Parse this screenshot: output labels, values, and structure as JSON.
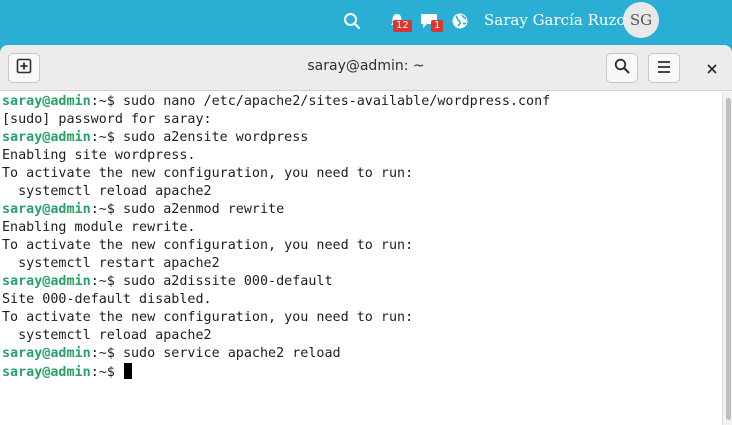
{
  "panel": {
    "icons": [
      "search-icon",
      "notifications-icon",
      "messages-icon",
      "network-globe-icon"
    ],
    "notifications_count": "12",
    "messages_count": "1",
    "user_name": "Saray García Ruzo",
    "avatar_initials": "SG"
  },
  "window": {
    "title": "saray@admin: ~",
    "buttons": [
      "new-tab-icon",
      "search-icon",
      "menu-icon",
      "close-icon"
    ]
  },
  "terminal": {
    "prompt_user": "saray@admin",
    "prompt_path": ":~$ ",
    "lines": [
      {
        "type": "prompt",
        "cmd": "sudo nano /etc/apache2/sites-available/wordpress.conf"
      },
      {
        "type": "out",
        "text": "[sudo] password for saray:"
      },
      {
        "type": "prompt",
        "cmd": "sudo a2ensite wordpress"
      },
      {
        "type": "out",
        "text": "Enabling site wordpress."
      },
      {
        "type": "out",
        "text": "To activate the new configuration, you need to run:"
      },
      {
        "type": "out",
        "text": "  systemctl reload apache2"
      },
      {
        "type": "prompt",
        "cmd": "sudo a2enmod rewrite"
      },
      {
        "type": "out",
        "text": "Enabling module rewrite."
      },
      {
        "type": "out",
        "text": "To activate the new configuration, you need to run:"
      },
      {
        "type": "out",
        "text": "  systemctl restart apache2"
      },
      {
        "type": "prompt",
        "cmd": "sudo a2dissite 000-default"
      },
      {
        "type": "out",
        "text": "Site 000-default disabled."
      },
      {
        "type": "out",
        "text": "To activate the new configuration, you need to run:"
      },
      {
        "type": "out",
        "text": "  systemctl reload apache2"
      },
      {
        "type": "prompt",
        "cmd": "sudo service apache2 reload"
      },
      {
        "type": "prompt",
        "cmd": "",
        "cursor": true
      }
    ]
  },
  "colors": {
    "desktop": "#29abd0",
    "prompt_user": "#26a269",
    "badge": "#d8362f"
  }
}
